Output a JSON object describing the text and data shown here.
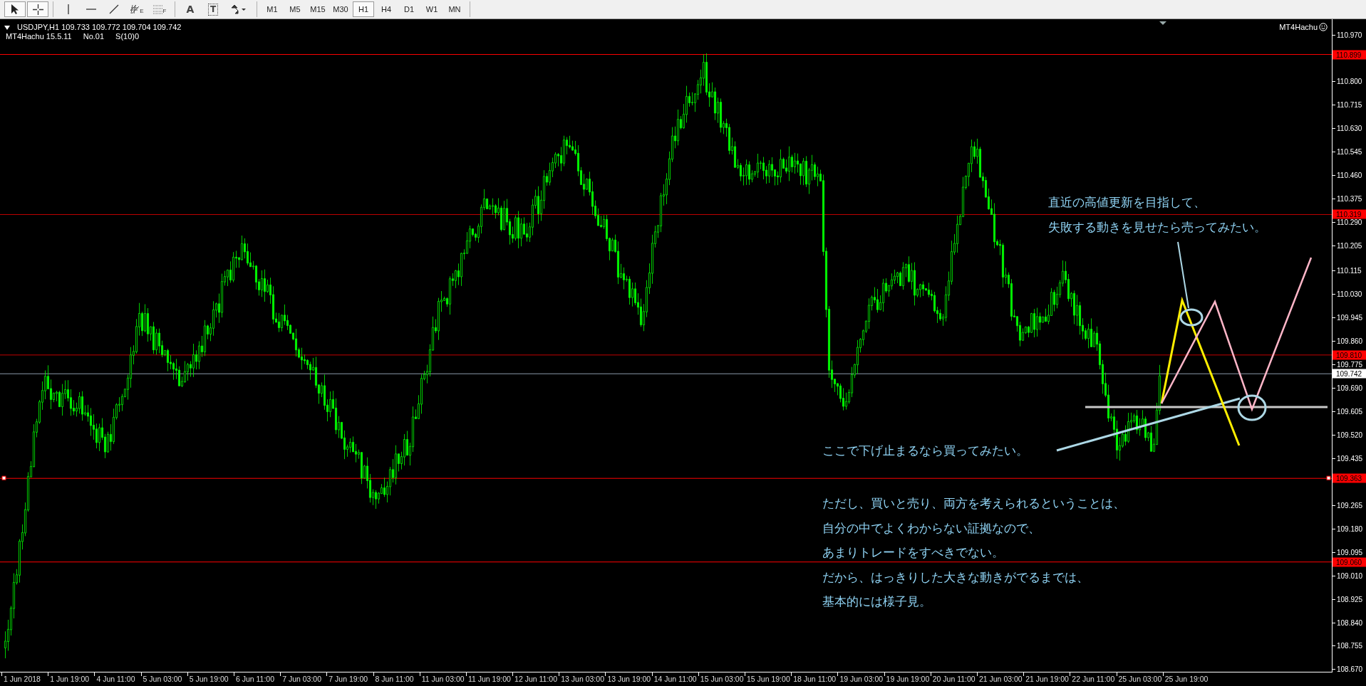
{
  "toolbar": {
    "tools": [
      {
        "kind": "cursor",
        "pressed": true
      },
      {
        "kind": "crosshair",
        "pressed": true
      },
      {
        "kind": "vline",
        "pressed": false
      },
      {
        "kind": "hline",
        "pressed": false
      },
      {
        "kind": "trendline",
        "pressed": false
      },
      {
        "kind": "channel",
        "sub": "E",
        "pressed": false
      },
      {
        "kind": "fibo",
        "sub": "F",
        "pressed": false
      },
      {
        "kind": "text",
        "label": "A",
        "pressed": false
      },
      {
        "kind": "label",
        "label": "T",
        "pressed": false
      },
      {
        "kind": "arrows",
        "pressed": false
      }
    ],
    "timeframes": [
      {
        "label": "M1",
        "selected": false
      },
      {
        "label": "M5",
        "selected": false
      },
      {
        "label": "M15",
        "selected": false
      },
      {
        "label": "M30",
        "selected": false
      },
      {
        "label": "H1",
        "selected": true
      },
      {
        "label": "H4",
        "selected": false
      },
      {
        "label": "D1",
        "selected": false
      },
      {
        "label": "W1",
        "selected": false
      },
      {
        "label": "MN",
        "selected": false
      }
    ]
  },
  "chart": {
    "symbol_line": "USDJPY,H1  109.733 109.772 109.704 109.742",
    "indicator": [
      "MT4Hachu 15.5.11",
      "No.01",
      "S(10)0"
    ],
    "expert": "MT4Hachu",
    "price_ticks": [
      "110.970",
      "110.800",
      "110.715",
      "110.630",
      "110.545",
      "110.460",
      "110.375",
      "110.290",
      "110.205",
      "110.115",
      "110.030",
      "109.945",
      "109.860",
      "109.775",
      "109.690",
      "109.605",
      "109.520",
      "109.435",
      "109.265",
      "109.180",
      "109.095",
      "109.010",
      "108.925",
      "108.840",
      "108.755",
      "108.670"
    ],
    "levels": [
      {
        "price": "110.899",
        "kind": "line"
      },
      {
        "price": "110.319",
        "kind": "line"
      },
      {
        "price": "109.810",
        "kind": "line"
      },
      {
        "price": "109.742",
        "kind": "bid"
      },
      {
        "price": "109.363",
        "kind": "line"
      },
      {
        "price": "109.060",
        "kind": "line"
      }
    ],
    "time_labels": [
      "1 Jun 2018",
      "1 Jun 19:00",
      "4 Jun 11:00",
      "5 Jun 03:00",
      "5 Jun 19:00",
      "6 Jun 11:00",
      "7 Jun 03:00",
      "7 Jun 19:00",
      "8 Jun 11:00",
      "11 Jun 03:00",
      "11 Jun 19:00",
      "12 Jun 11:00",
      "13 Jun 03:00",
      "13 Jun 19:00",
      "14 Jun 11:00",
      "15 Jun 03:00",
      "15 Jun 19:00",
      "18 Jun 11:00",
      "19 Jun 03:00",
      "19 Jun 19:00",
      "20 Jun 11:00",
      "21 Jun 03:00",
      "21 Jun 19:00",
      "22 Jun 11:00",
      "25 Jun 03:00",
      "25 Jun 19:00"
    ],
    "notes": [
      {
        "lines": [
          "直近の高値更新を目指して、",
          "失敗する動きを見せたら売ってみたい。"
        ]
      },
      {
        "lines": [
          "ここで下げ止まるなら買ってみたい。"
        ]
      },
      {
        "lines": [
          "ただし、買いと売り、両方を考えられるということは、",
          "自分の中でよくわからない証拠なので、",
          "あまりトレードをすべきでない。",
          "だから、はっきりした大きな動きがでるまでは、",
          "基本的には様子見。"
        ]
      }
    ]
  }
}
